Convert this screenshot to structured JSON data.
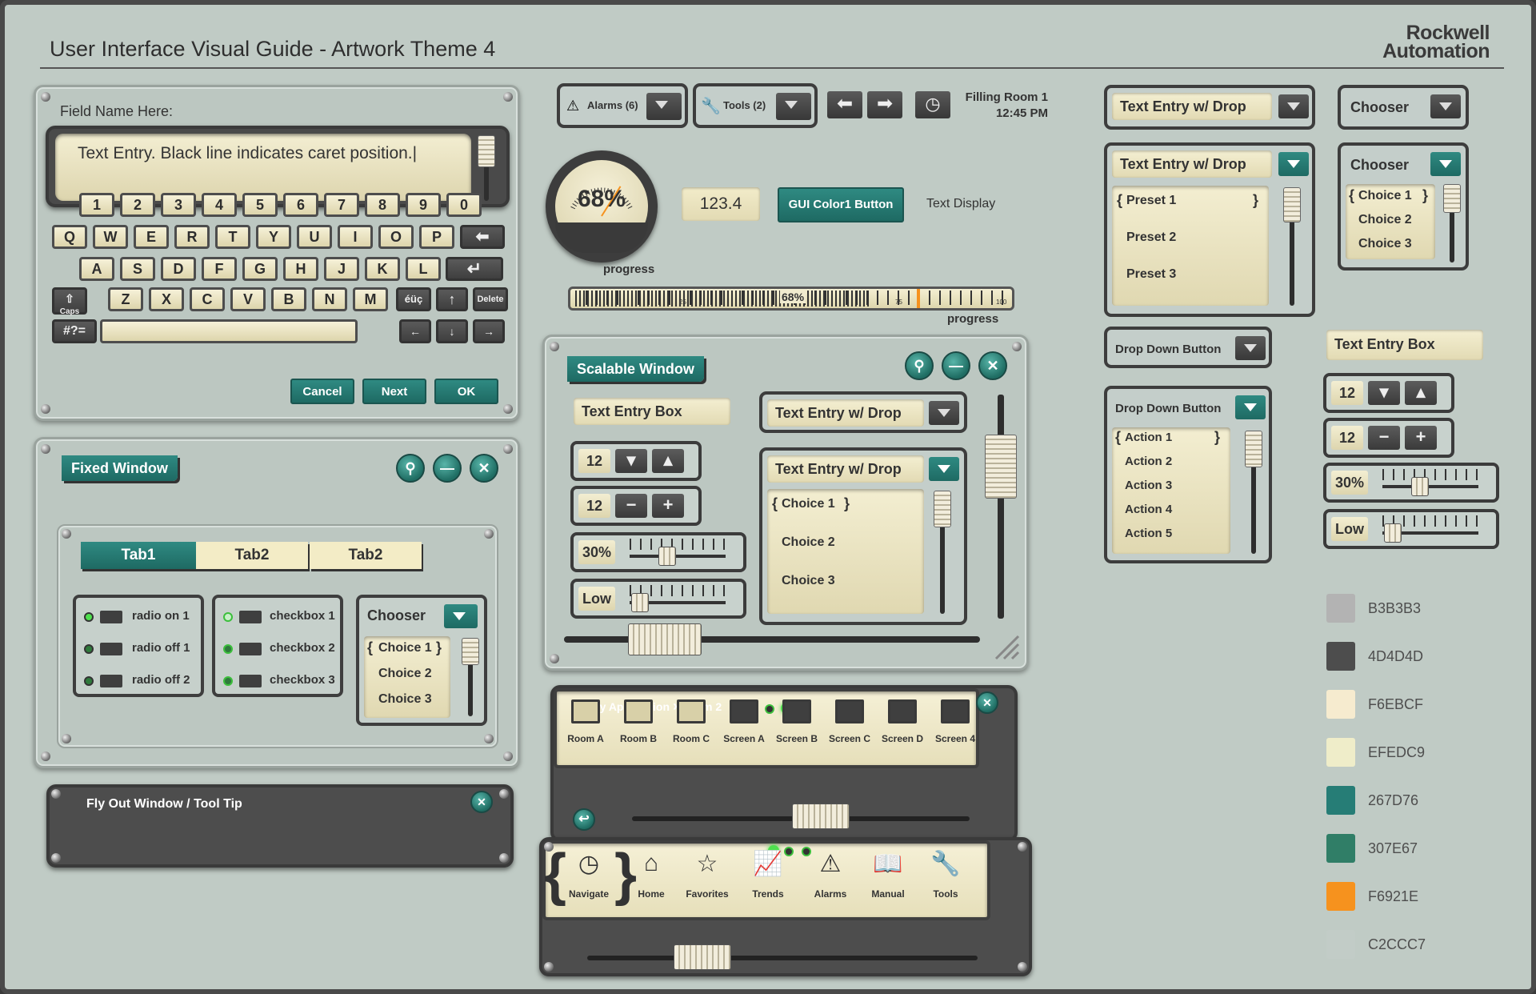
{
  "header": {
    "title": "User Interface Visual Guide - Artwork Theme 4",
    "logo_line1": "Rockwell",
    "logo_line2": "Automation"
  },
  "keyboard_panel": {
    "field_label": "Field Name Here:",
    "text_entry": "Text Entry. Black line indicates caret position.|",
    "row1": [
      "1",
      "2",
      "3",
      "4",
      "5",
      "6",
      "7",
      "8",
      "9",
      "0"
    ],
    "row2": [
      "Q",
      "W",
      "E",
      "R",
      "T",
      "Y",
      "U",
      "I",
      "O",
      "P"
    ],
    "row3": [
      "A",
      "S",
      "D",
      "F",
      "G",
      "H",
      "J",
      "K",
      "L"
    ],
    "row4": [
      "Z",
      "X",
      "C",
      "V",
      "B",
      "N",
      "M"
    ],
    "caps": "Caps",
    "intl": "éüç",
    "delete": "Delete",
    "sym": "#?=",
    "cancel": "Cancel",
    "next": "Next",
    "ok": "OK"
  },
  "toolbar": {
    "alarms": "Alarms (6)",
    "tools": "Tools (2)",
    "status_line1": "Filling Room 1",
    "status_line2": "12:45 PM"
  },
  "gauge": {
    "value": "68%",
    "label": "progress",
    "fraction": 0.68
  },
  "numeric_display": "123.4",
  "gui_button": "GUI Color1 Button",
  "text_display": "Text Display",
  "progress_bar": {
    "value": "68%",
    "label": "progress",
    "tick_25": "25",
    "tick_75": "75",
    "tick_100": "100",
    "fraction": 0.68
  },
  "fixed_window": {
    "title": "Fixed Window",
    "tabs": [
      "Tab1",
      "Tab2",
      "Tab2"
    ],
    "radios": [
      "radio on 1",
      "radio off 1",
      "radio off 2"
    ],
    "checkboxes": [
      "checkbox 1",
      "checkbox 2",
      "checkbox 3"
    ],
    "chooser": "Chooser",
    "choices": [
      "Choice 1",
      "Choice 2",
      "Choice 3"
    ]
  },
  "flyout": {
    "title": "Fly Out Window / Tool Tip"
  },
  "scalable_window": {
    "title": "Scalable Window",
    "text_entry_box": "Text Entry Box",
    "text_entry_drop": "Text Entry w/ Drop",
    "spin1": "12",
    "spin2": "12",
    "slider_pct": "30%",
    "slider_low": "Low",
    "choices": [
      "Choice 1",
      "Choice 2",
      "Choice 3"
    ]
  },
  "app_panel": {
    "breadcrumb_app": "My Application",
    "breadcrumb_room": "Room 2",
    "items": [
      "Room A",
      "Room B",
      "Room C",
      "Screen A",
      "Screen B",
      "Screen C",
      "Screen D",
      "Screen 4"
    ]
  },
  "nav_panel": {
    "items": [
      "Navigate",
      "Home",
      "Favorites",
      "Trends",
      "Alarms",
      "Manual",
      "Tools"
    ]
  },
  "right_col": {
    "text_entry_drop": "Text Entry w/ Drop",
    "chooser": "Chooser",
    "presets": [
      "Preset 1",
      "Preset 2",
      "Preset 3"
    ],
    "choices": [
      "Choice 1",
      "Choice 2",
      "Choice 3"
    ],
    "drop_down_button": "Drop Down Button",
    "actions": [
      "Action 1",
      "Action 2",
      "Action 3",
      "Action 4",
      "Action 5"
    ],
    "text_entry_box": "Text Entry Box",
    "spin1": "12",
    "spin2": "12",
    "pct": "30%",
    "low": "Low"
  },
  "swatches": [
    {
      "hex": "#B3B3B3",
      "label": "B3B3B3"
    },
    {
      "hex": "#4D4D4D",
      "label": "4D4D4D"
    },
    {
      "hex": "#F6EBCF",
      "label": "F6EBCF"
    },
    {
      "hex": "#EFEDC9",
      "label": "EFEDC9"
    },
    {
      "hex": "#267D76",
      "label": "267D76"
    },
    {
      "hex": "#307E67",
      "label": "307E67"
    },
    {
      "hex": "#F6921E",
      "label": "F6921E"
    },
    {
      "hex": "#C2CCC7",
      "label": "C2CCC7"
    }
  ]
}
